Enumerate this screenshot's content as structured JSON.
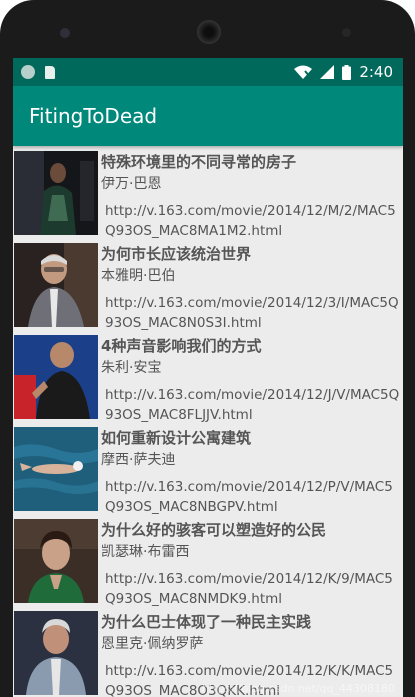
{
  "status_bar": {
    "time": "2:40",
    "icons": [
      "notification-circle-icon",
      "sd-card-icon",
      "wifi-icon",
      "signal-icon",
      "battery-icon"
    ]
  },
  "app_bar": {
    "title": "FitingToDead"
  },
  "colors": {
    "status_bar": "#00695c",
    "app_bar": "#00897b",
    "list_bg": "#ececec",
    "text": "#555555"
  },
  "items": [
    {
      "title": "特殊环境里的不同寻常的房子",
      "author": "伊万·巴恩",
      "url": "http://v.163.com/movie/2014/12/M/2/MAC5Q93OS_MAC8MA1M2.html",
      "thumb": "dark-scene-photo"
    },
    {
      "title": "为何市长应该统治世界",
      "author": "本雅明·巴伯",
      "url": "http://v.163.com/movie/2014/12/3/I/MAC5Q93OS_MAC8N0S3I.html",
      "thumb": "speaker-photo"
    },
    {
      "title": "4种声音影响我们的方式",
      "author": "朱利·安宝",
      "url": "http://v.163.com/movie/2014/12/J/V/MAC5Q93OS_MAC8FLJJV.html",
      "thumb": "speaker-red-bg-photo"
    },
    {
      "title": "如何重新设计公寓建筑",
      "author": "摩西·萨夫迪",
      "url": "http://v.163.com/movie/2014/12/P/V/MAC5Q93OS_MAC8NBGPV.html",
      "thumb": "swimmer-photo"
    },
    {
      "title": "为什么好的骇客可以塑造好的公民",
      "author": "凯瑟琳·布雷西",
      "url": "http://v.163.com/movie/2014/12/K/9/MAC5Q93OS_MAC8NMDK9.html",
      "thumb": "woman-speaker-photo"
    },
    {
      "title": "为什么巴士体现了一种民主实践",
      "author": "恩里克·佩纳罗萨",
      "url": "http://v.163.com/movie/2014/12/K/K/MAC5Q93OS_MAC8O3QKK.html",
      "thumb": "man-speaker-photo"
    }
  ],
  "watermark": "https://blog.csdn.net/qq_44308180"
}
